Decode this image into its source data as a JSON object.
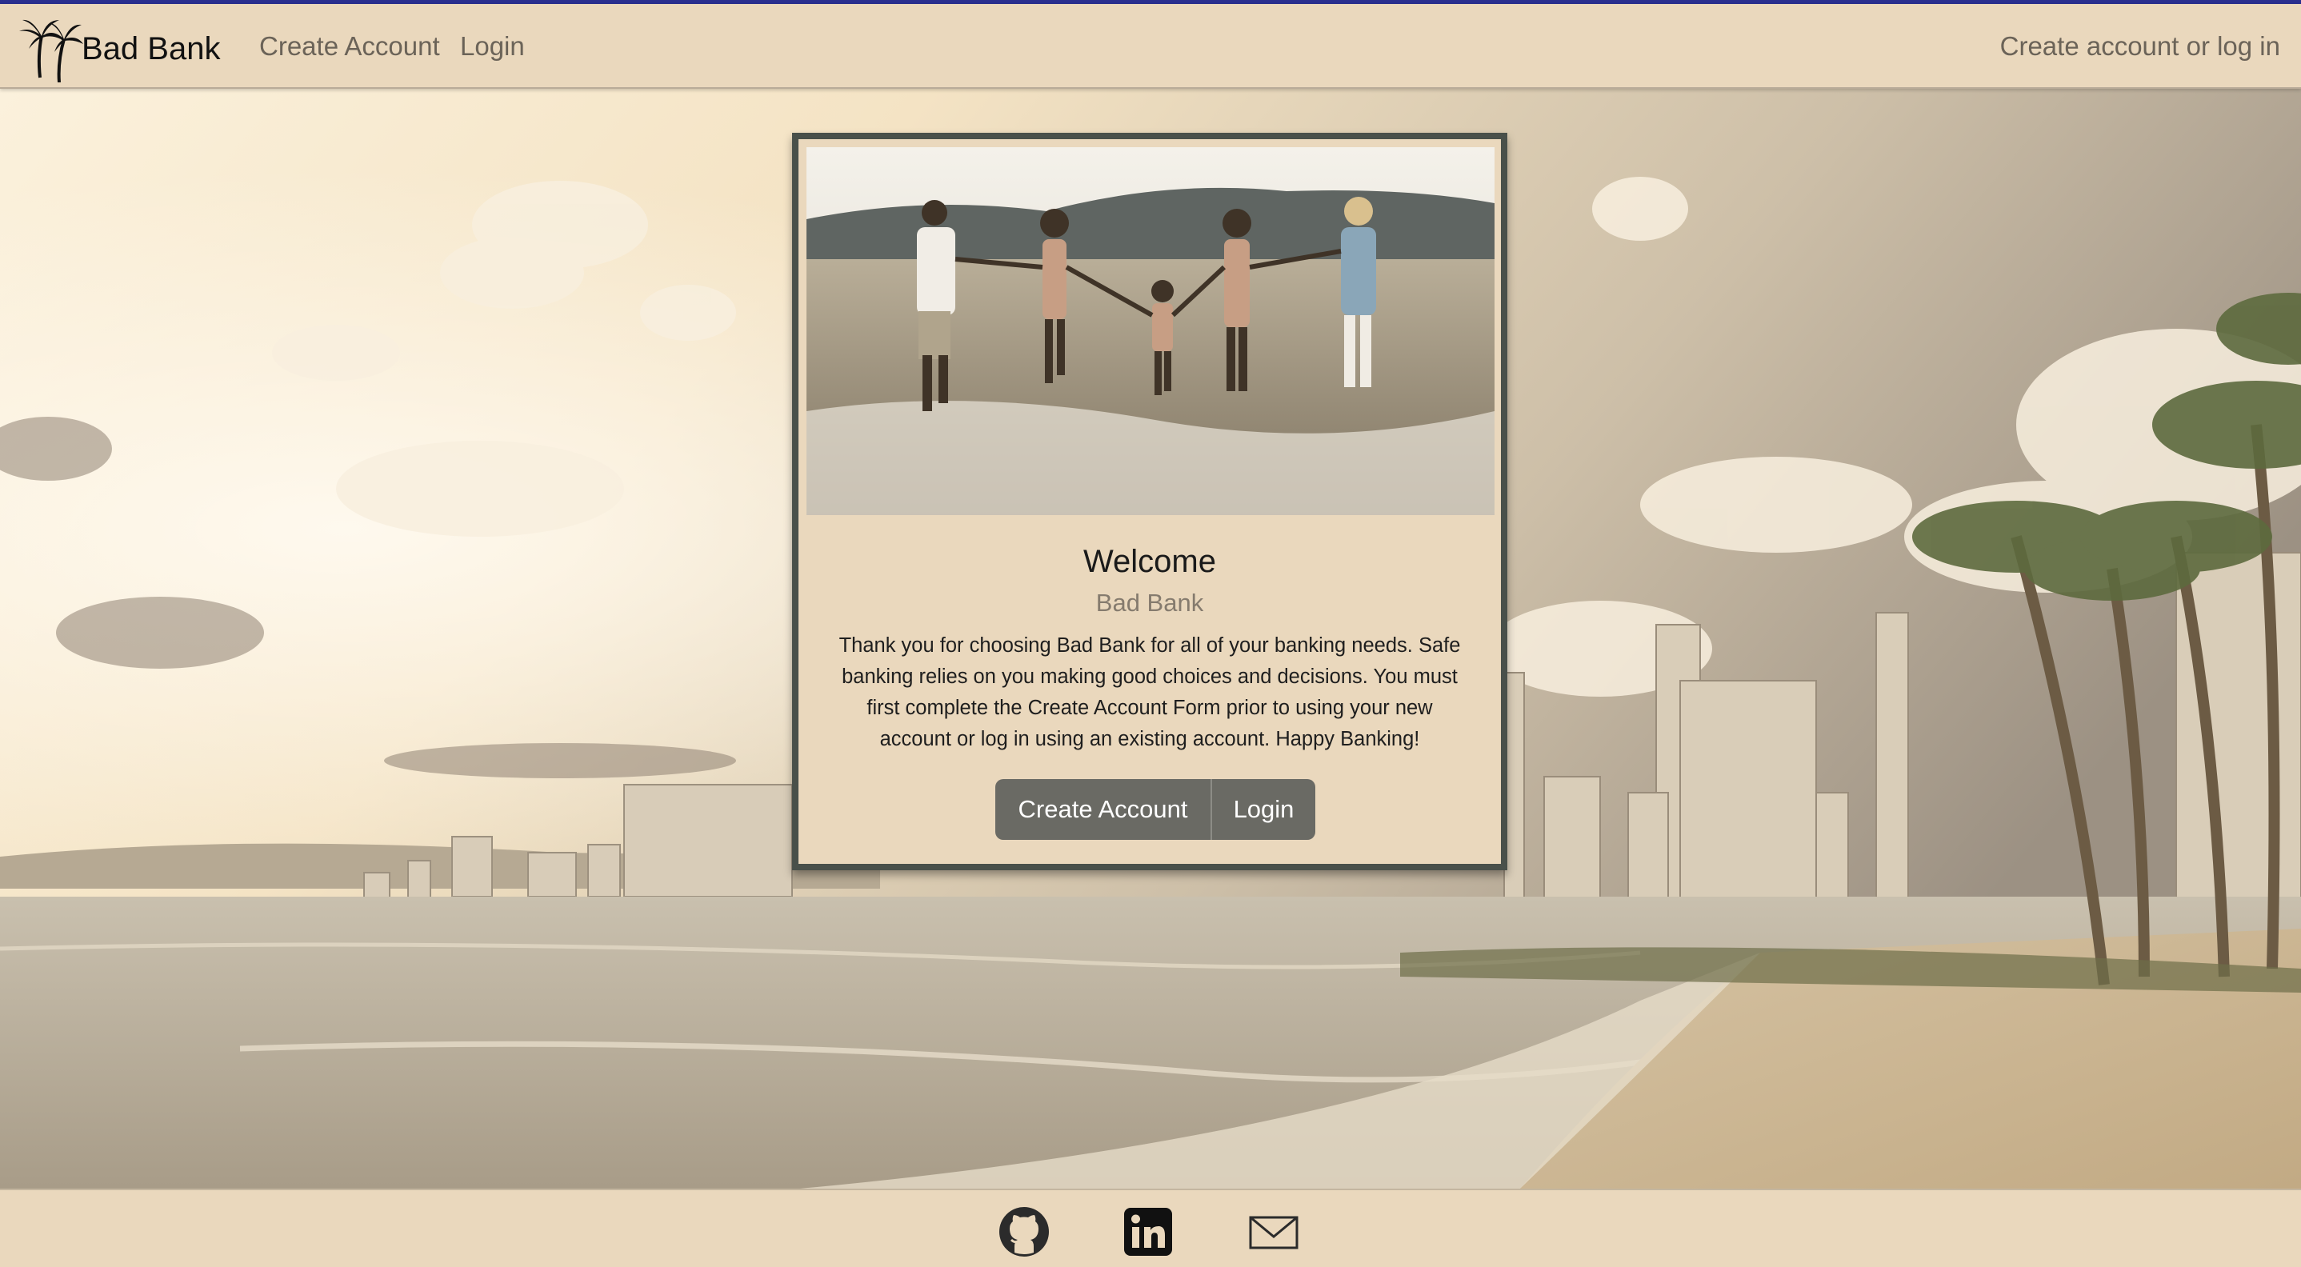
{
  "navbar": {
    "brand_icon": "palm-trees-icon",
    "brand": "Bad Bank",
    "links": [
      {
        "label": "Create Account"
      },
      {
        "label": "Login"
      }
    ],
    "status": "Create account or log in"
  },
  "card": {
    "title": "Welcome",
    "subtitle": "Bad Bank",
    "text": "Thank you for choosing Bad Bank for all of your banking needs. Safe banking relies on you making good choices and decisions. You must first complete the Create Account Form prior to using your new account or log in using an existing account. Happy Banking!",
    "buttons": {
      "create": "Create Account",
      "login": "Login"
    }
  },
  "footer": {
    "icons": [
      "github-icon",
      "linkedin-icon",
      "mail-icon"
    ]
  },
  "colors": {
    "panel": "#ead8bd",
    "button": "#6a6a64",
    "card_border": "#49504a",
    "top_accent": "#2a2f8f"
  }
}
